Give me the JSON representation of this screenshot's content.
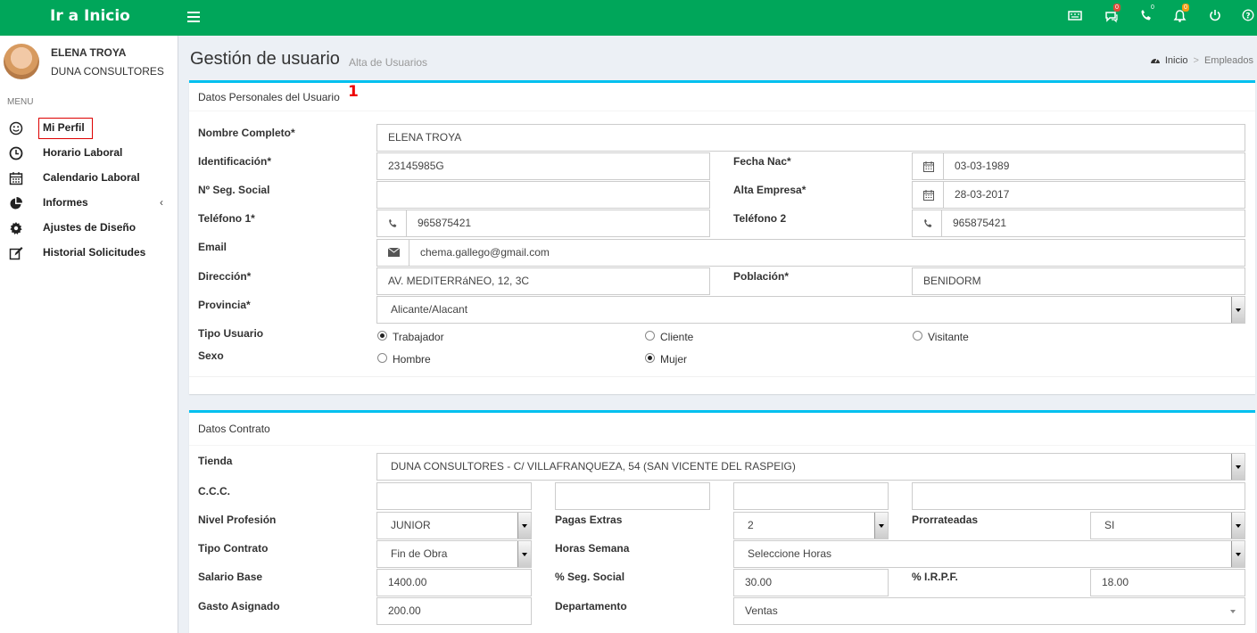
{
  "header": {
    "logo": "Ir a Inicio",
    "badges": {
      "messages": "0",
      "phone": "0",
      "notifications": "0"
    },
    "accent": "#00a65a"
  },
  "sidebar": {
    "user_name": "ELENA TROYA",
    "company": "DUNA CONSULTORES",
    "menu_header": "MENU",
    "items": [
      {
        "label": "Mi Perfil",
        "icon": "smile-icon"
      },
      {
        "label": "Horario Laboral",
        "icon": "clock-icon"
      },
      {
        "label": "Calendario Laboral",
        "icon": "calendar-icon"
      },
      {
        "label": "Informes",
        "icon": "pie-chart-icon",
        "chevron": "‹"
      },
      {
        "label": "Ajustes de Diseño",
        "icon": "gear-icon"
      },
      {
        "label": "Historial Solicitudes",
        "icon": "edit-icon"
      }
    ]
  },
  "page": {
    "title": "Gestión de usuario",
    "subtitle": "Alta de Usuarios"
  },
  "breadcrumb": {
    "home": "Inicio",
    "sep": ">",
    "current": "Empleados"
  },
  "personal": {
    "title": "Datos Personales del Usuario",
    "marker": "1",
    "labels": {
      "nombre": "Nombre Completo*",
      "ident": "Identificación*",
      "fecha_nac": "Fecha Nac*",
      "seg_social": "Nº Seg. Social",
      "alta": "Alta Empresa*",
      "tel1": "Teléfono 1*",
      "tel2": "Teléfono 2",
      "email": "Email",
      "direccion": "Dirección*",
      "poblacion": "Población*",
      "provincia": "Provincia*",
      "tipo_usuario": "Tipo Usuario",
      "sexo": "Sexo"
    },
    "values": {
      "nombre": "ELENA TROYA",
      "ident": "23145985G",
      "fecha_nac": "03-03-1989",
      "seg_social": "",
      "alta": "28-03-2017",
      "tel1": "965875421",
      "tel2": "965875421",
      "email": "chema.gallego@gmail.com",
      "direccion": "AV. MEDITERRáNEO, 12, 3C",
      "poblacion": "BENIDORM",
      "provincia": "Alicante/Alacant"
    },
    "tipo_usuario": {
      "options": [
        "Trabajador",
        "Cliente",
        "Visitante"
      ],
      "selected": "Trabajador"
    },
    "sexo": {
      "options": [
        "Hombre",
        "Mujer"
      ],
      "selected": "Mujer"
    }
  },
  "contrato": {
    "title": "Datos Contrato",
    "labels": {
      "tienda": "Tienda",
      "ccc": "C.C.C.",
      "nivel": "Nivel Profesión",
      "pagas": "Pagas Extras",
      "prorrateadas": "Prorrateadas",
      "tipo": "Tipo Contrato",
      "horas": "Horas Semana",
      "salario": "Salario Base",
      "seg_social": "% Seg. Social",
      "irpf": "% I.R.P.F.",
      "gasto": "Gasto Asignado",
      "departamento": "Departamento"
    },
    "values": {
      "tienda": "DUNA CONSULTORES - C/ VILLAFRANQUEZA, 54 (SAN VICENTE DEL RASPEIG)",
      "ccc": [
        "",
        "",
        "",
        ""
      ],
      "nivel": "JUNIOR",
      "pagas": "2",
      "prorrateadas": "SI",
      "tipo": "Fin de Obra",
      "horas": "Seleccione Horas",
      "salario": "1400.00",
      "seg_social": "30.00",
      "irpf": "18.00",
      "gasto": "200.00",
      "departamento": "Ventas"
    }
  }
}
